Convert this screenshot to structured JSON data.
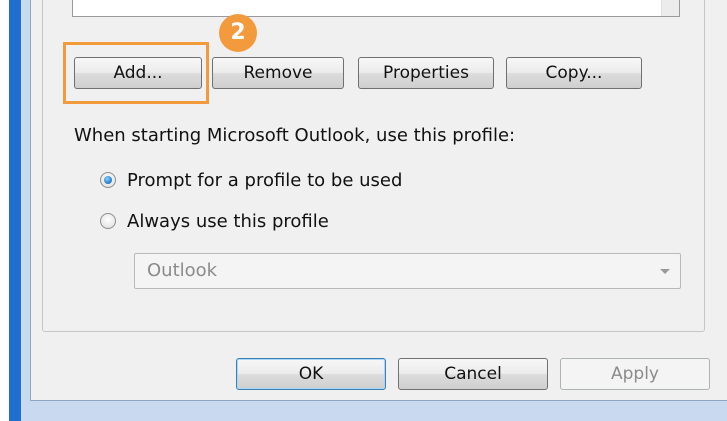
{
  "step_badge": "2",
  "profile_buttons": {
    "add": "Add...",
    "remove": "Remove",
    "properties": "Properties",
    "copy": "Copy..."
  },
  "startup": {
    "label": "When starting Microsoft Outlook, use this profile:",
    "options": [
      {
        "label": "Prompt for a profile to be used",
        "selected": true
      },
      {
        "label": "Always use this profile",
        "selected": false
      }
    ],
    "profile_select": {
      "value": "Outlook",
      "enabled": false
    }
  },
  "dialog_buttons": {
    "ok": "OK",
    "cancel": "Cancel",
    "apply": "Apply"
  },
  "colors": {
    "highlight": "#f39a3c",
    "window_accent": "#1e6fd0",
    "dialog_background": "#f0f0f0"
  }
}
